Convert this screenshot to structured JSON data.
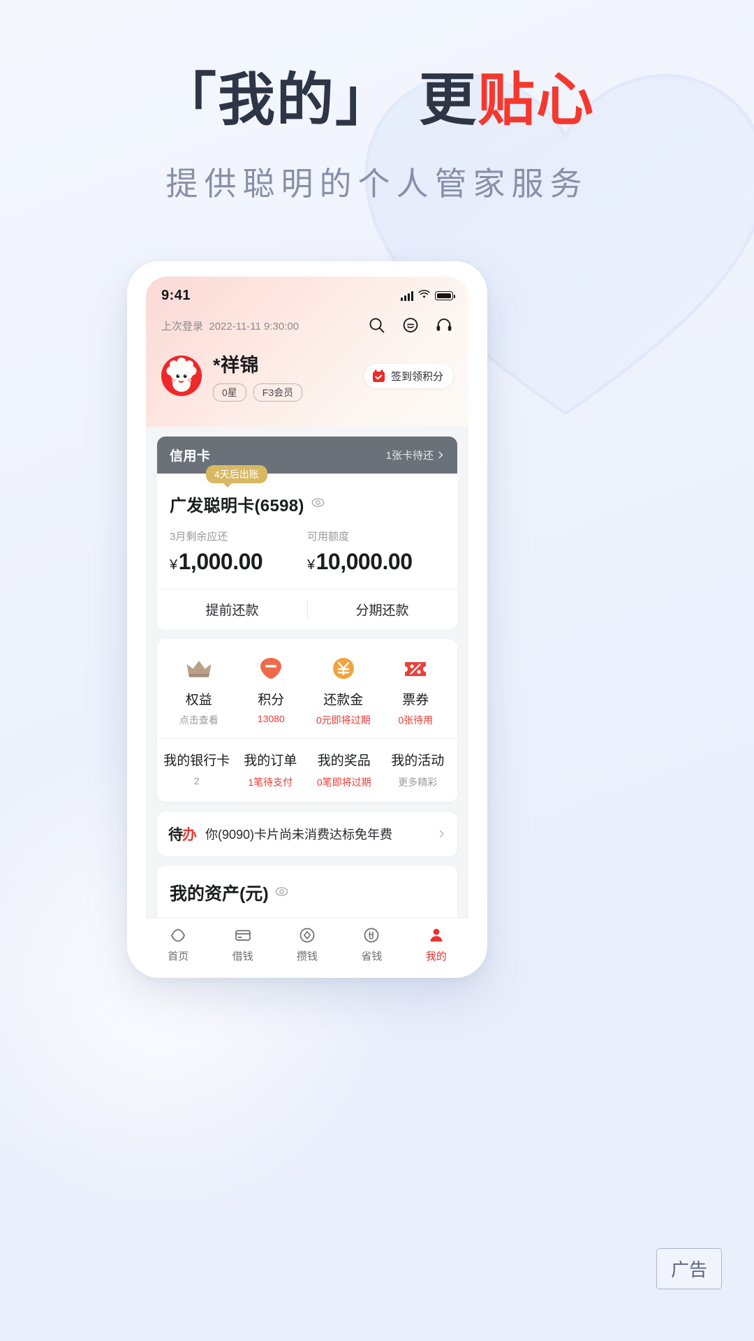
{
  "hero": {
    "title_part1": "「我的」",
    "title_part2": "更",
    "title_accent": "贴心",
    "subtitle": "提供聪明的个人管家服务",
    "accent_color": "#f4382f",
    "title_color": "#2e3547",
    "subtitle_color": "#8890a8"
  },
  "phone": {
    "statusbar": {
      "time": "9:41",
      "signal": "signal-bars",
      "wifi": "wifi-icon",
      "battery": "battery-full-icon"
    },
    "header": {
      "last_login_label": "上次登录",
      "last_login_value": "2022-11-11 9:30:00",
      "actions": [
        {
          "name": "search-icon",
          "label": "搜索"
        },
        {
          "name": "message-icon",
          "label": "消息"
        },
        {
          "name": "headset-icon",
          "label": "客服"
        }
      ]
    },
    "profile": {
      "username": "*祥锦",
      "avatar": "sheep-avatar",
      "badges": [
        "0星",
        "F3会员"
      ],
      "signin_label": "签到领积分",
      "signin_icon": "calendar-check-icon"
    },
    "credit_card": {
      "head_title": "信用卡",
      "head_right": "1张卡待还",
      "chevron": "chevron-right-icon",
      "tip": "4天后出账",
      "card_name": "广发聪明卡(6598)",
      "eye_icon": "eye-icon",
      "amounts": [
        {
          "label": "3月剩余应还",
          "currency": "¥",
          "value": "1,000.00"
        },
        {
          "label": "可用额度",
          "currency": "¥",
          "value": "10,000.00"
        }
      ],
      "actions": [
        "提前还款",
        "分期还款"
      ]
    },
    "quick_grid": [
      {
        "icon": "crown-icon",
        "title": "权益",
        "sub": "点击查看",
        "sub_red": false
      },
      {
        "icon": "points-icon",
        "title": "积分",
        "sub": "13080",
        "sub_red": true
      },
      {
        "icon": "yen-coin-icon",
        "title": "还款金",
        "sub": "0元即将过期",
        "sub_red": true
      },
      {
        "icon": "coupon-icon",
        "title": "票券",
        "sub": "0张待用",
        "sub_red": true
      }
    ],
    "quick_links": [
      {
        "title": "我的银行卡",
        "sub": "2",
        "sub_red": false
      },
      {
        "title": "我的订单",
        "sub": "1笔待支付",
        "sub_red": true
      },
      {
        "title": "我的奖品",
        "sub": "0笔即将过期",
        "sub_red": true
      },
      {
        "title": "我的活动",
        "sub": "更多精彩",
        "sub_red": false
      }
    ],
    "todo": {
      "badge_first": "待",
      "badge_second": "办",
      "text": "你(9090)卡片尚未消费达标免年费",
      "chevron": "chevron-right-icon"
    },
    "assets": {
      "title": "我的资产(元)",
      "eye_icon": "eye-icon"
    },
    "tabbar": [
      {
        "icon": "home-icon",
        "label": "首页",
        "active": false
      },
      {
        "icon": "card-icon",
        "label": "借钱",
        "active": false
      },
      {
        "icon": "diamond-icon",
        "label": "攒钱",
        "active": false
      },
      {
        "icon": "save-icon",
        "label": "省钱",
        "active": false
      },
      {
        "icon": "person-icon",
        "label": "我的",
        "active": true
      }
    ]
  },
  "ad_badge": "广告"
}
